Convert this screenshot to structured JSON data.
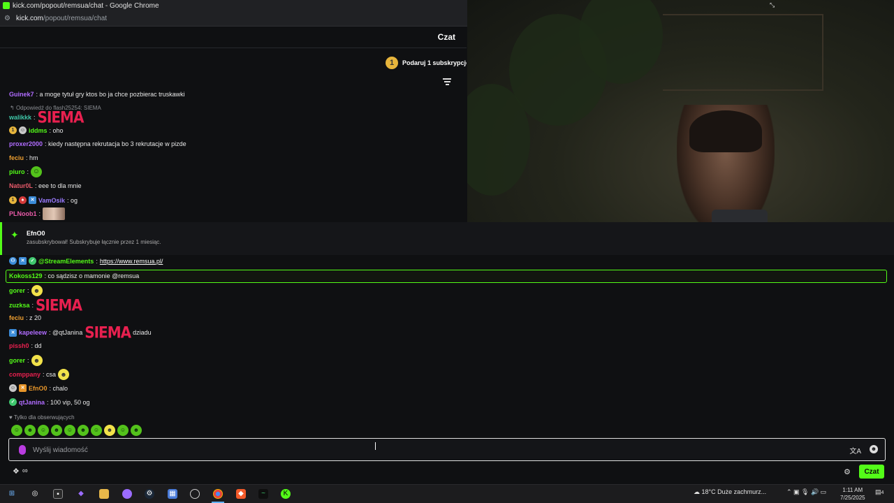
{
  "window": {
    "title": "kick.com/popout/remsua/chat - Google Chrome",
    "url_host": "kick.com",
    "url_path": "/popout/remsua/chat"
  },
  "chat": {
    "title": "Czat",
    "gift_count": "1",
    "gift_label": "Podaruj 1 subskrypcję"
  },
  "messages": [
    {
      "user": "Guinek7",
      "color": "#b06cff",
      "text": ": a moge tytuł gry ktos bo ja chce pozbierac truskawki"
    },
    {
      "reply": "Odpowiedź do flash25254: SIEMA"
    },
    {
      "user": "walikkk",
      "color": "#3fc7a8",
      "text": ":",
      "emote": "SIEMA"
    },
    {
      "user": "iddms",
      "color": "#53fc18",
      "text": ": oho"
    },
    {
      "user": "proxer2000",
      "color": "#b06cff",
      "text": ": kiedy następna rekrutacja bo 3 rekrutacje w pizde"
    },
    {
      "user": "feciu",
      "color": "#f0a030",
      "text": ": hm"
    },
    {
      "user": "piuro",
      "color": "#53fc18",
      "text": ":"
    },
    {
      "user": "Natur0L",
      "color": "#e85a6a",
      "text": ": eee to dla mnie"
    },
    {
      "user": "VamOsik",
      "color": "#9b7bff",
      "text": ": og"
    },
    {
      "user": "PLNoob1",
      "color": "#e85aa8",
      "text": ":"
    },
    {
      "user": "@StreamElements",
      "color": "#53fc18",
      "text": ": ",
      "link": "https://www.remsua.pl/"
    },
    {
      "user": "Kokoss129",
      "color": "#53fc18",
      "text": ": co sądzisz o mamonie @remsua"
    },
    {
      "user": "gorer",
      "color": "#53fc18",
      "text": ":"
    },
    {
      "user": "zuzksa",
      "color": "#53fc18",
      "text": ":",
      "emote": "SIEMA"
    },
    {
      "user": "feciu",
      "color": "#f0a030",
      "text": ": z 20"
    },
    {
      "user": "kapeleew",
      "color": "#b06cff",
      "text": ": @qtJanina",
      "emote": "SIEMA",
      "after": "dziadu"
    },
    {
      "user": "pissh0",
      "color": "#e8204f",
      "text": ": dd"
    },
    {
      "user": "gorer",
      "color": "#53fc18",
      "text": ":"
    },
    {
      "user": "comppany",
      "color": "#e8204f",
      "text": ": csa"
    },
    {
      "user": "EfnO0",
      "color": "#e8962a",
      "text": ": chalo"
    },
    {
      "user": "qtJanina",
      "color": "#b06cff",
      "text": ": 100 vip, 50 og"
    }
  ],
  "sub_event": {
    "name": "EfnO0",
    "desc": "zasubskrybował! Subskrybuje łącznie przez 1 miesiąc."
  },
  "followers_only": "Tylko dla obserwujących",
  "input": {
    "placeholder": "Wyślij wiadomość"
  },
  "send_label": "Czat",
  "taskbar": {
    "weather": "18°C  Duże zachmurz...",
    "time": "1:11 AM",
    "date": "7/25/2025",
    "notif_count": "4"
  },
  "icons": {
    "mic": "mic-icon",
    "translate": "translate-icon",
    "emoji": "emoji-icon",
    "gear": "gear-icon",
    "filter": "filter-icon"
  }
}
